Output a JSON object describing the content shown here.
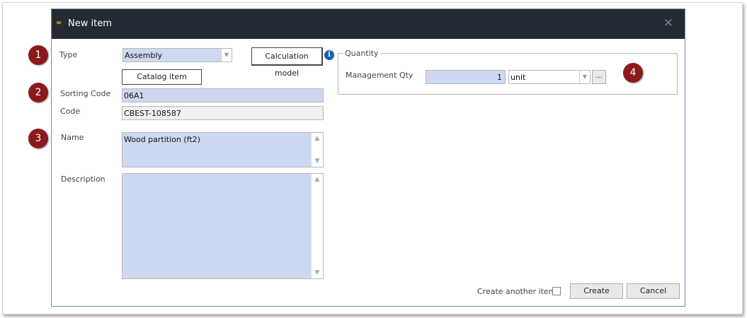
{
  "dialog": {
    "title": "New item",
    "app_icon": "∞",
    "close": "✕"
  },
  "badges": [
    "1",
    "2",
    "3",
    "4"
  ],
  "form": {
    "type_label": "Type",
    "type_value": "Assembly",
    "calc_model_label": "Calculation model",
    "info_icon": "i",
    "catalog_label": "Catalog item",
    "sorting_label": "Sorting Code",
    "sorting_value": "06A1",
    "code_label": "Code",
    "code_value": "CBEST-108587",
    "name_label": "Name",
    "name_value": "Wood partition (ft2)",
    "description_label": "Description",
    "description_value": ""
  },
  "quantity": {
    "legend": "Quantity",
    "mgmt_label": "Management Qty",
    "qty_value": "1",
    "unit_value": "unit",
    "more_label": "..."
  },
  "footer": {
    "create_another_label": "Create another item",
    "create_label": "Create",
    "cancel_label": "Cancel"
  }
}
